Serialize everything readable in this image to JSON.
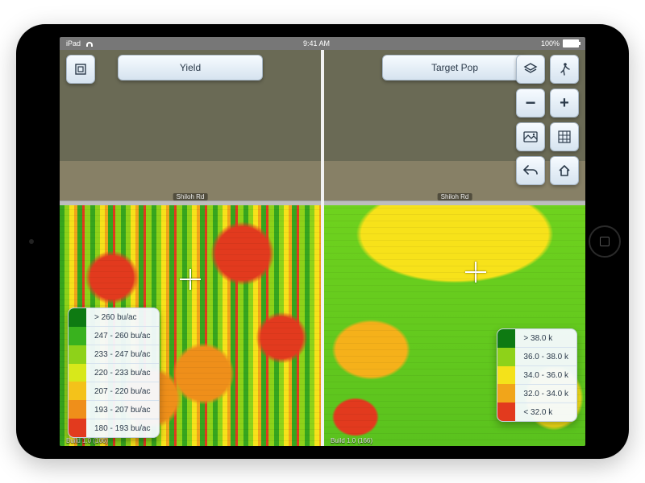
{
  "statusbar": {
    "device": "iPad",
    "time": "9:41 AM",
    "battery_pct": "100%"
  },
  "left_pane": {
    "mode_button": "Yield",
    "road_label": "Shiloh Rd",
    "build_label": "Build 1.0 (166)",
    "legend": [
      {
        "label": "> 260 bu/ac",
        "color": "#0e7a12"
      },
      {
        "label": "247 - 260 bu/ac",
        "color": "#39b21e"
      },
      {
        "label": "233 - 247 bu/ac",
        "color": "#8ed219"
      },
      {
        "label": "220 - 233 bu/ac",
        "color": "#d8e81a"
      },
      {
        "label": "207 - 220 bu/ac",
        "color": "#f4c21a"
      },
      {
        "label": "193 - 207 bu/ac",
        "color": "#ef8f1a"
      },
      {
        "label": "180 - 193 bu/ac",
        "color": "#e23a1e"
      }
    ]
  },
  "right_pane": {
    "mode_button": "Target Pop",
    "road_label": "Shiloh Rd",
    "build_label": "Build 1.0 (166)",
    "legend": [
      {
        "label": "> 38.0 k",
        "color": "#0e7a12"
      },
      {
        "label": "36.0 - 38.0 k",
        "color": "#8ed219"
      },
      {
        "label": "34.0 - 36.0 k",
        "color": "#f4e21a"
      },
      {
        "label": "32.0 - 34.0 k",
        "color": "#f1a51a"
      },
      {
        "label": "< 32.0 k",
        "color": "#e23a1e"
      }
    ]
  },
  "tools": {
    "layers": "layers",
    "walk": "walk",
    "zoom_out": "−",
    "zoom_in": "+",
    "photo": "photo",
    "grid": "grid",
    "back": "back",
    "home": "home"
  }
}
